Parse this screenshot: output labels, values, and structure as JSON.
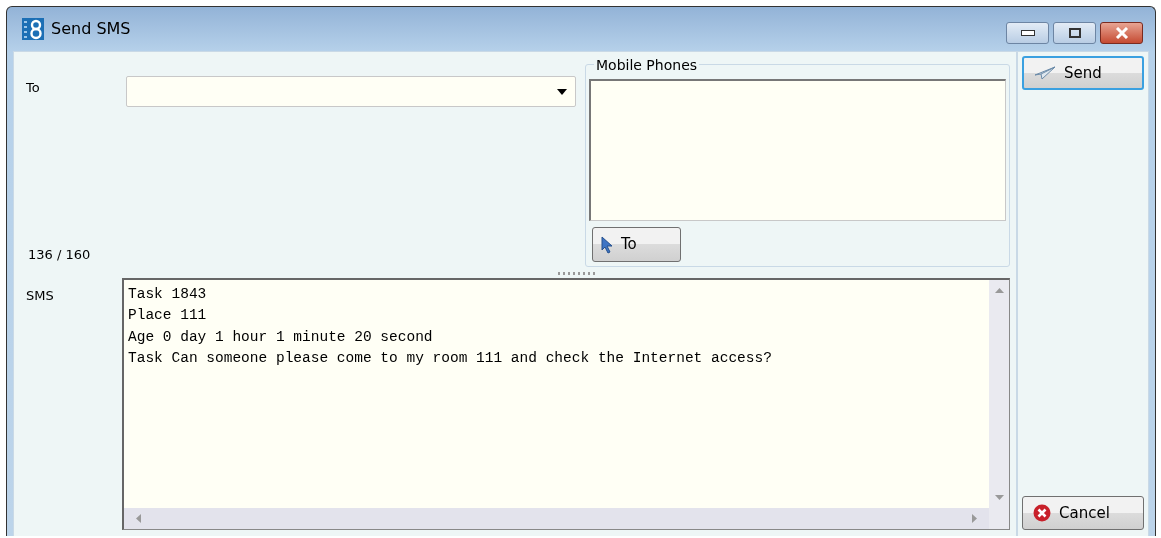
{
  "window": {
    "title": "Send SMS"
  },
  "to": {
    "label": "To"
  },
  "mobile_phones": {
    "title": "Mobile Phones",
    "button": "To"
  },
  "counter": "136 / 160",
  "sms": {
    "label": "SMS",
    "lines": [
      "Task 1843",
      "Place 111",
      "Age 0 day 1 hour 1 minute 20 second",
      "Task Can someone please come to my room 111 and check the Internet access?"
    ]
  },
  "buttons": [
    {
      "kind": "send",
      "label": "Send"
    },
    {
      "kind": "cancel",
      "label": "Cancel"
    }
  ]
}
